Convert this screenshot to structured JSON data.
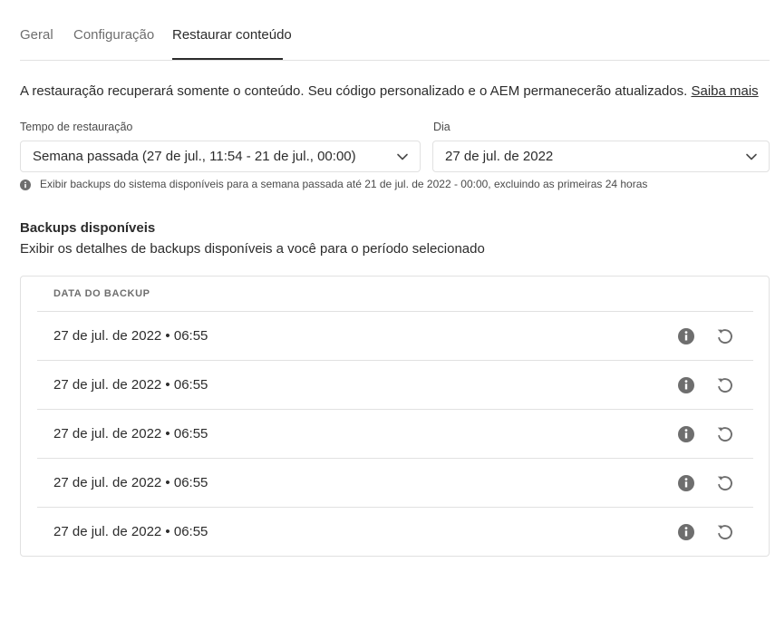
{
  "tabs": [
    {
      "label": "Geral",
      "active": false
    },
    {
      "label": "Configuração",
      "active": false
    },
    {
      "label": "Restaurar conteúdo",
      "active": true
    }
  ],
  "intro": {
    "text": "A restauração recuperará somente o conteúdo. Seu código personalizado e o AEM permanecerão atualizados. ",
    "link_label": "Saiba mais"
  },
  "restore_time": {
    "label": "Tempo de restauração",
    "selected": "Semana passada (27 de jul., 11:54 - 21 de jul., 00:00)"
  },
  "day": {
    "label": "Dia",
    "selected": "27 de jul. de 2022"
  },
  "hint": "Exibir backups do sistema disponíveis para a semana passada até 21 de jul. de 2022 - 00:00, excluindo as primeiras 24 horas",
  "backups": {
    "title": "Backups disponíveis",
    "description": "Exibir os detalhes de backups disponíveis a você para o período selecionado",
    "column_header": "DATA DO BACKUP",
    "rows": [
      {
        "date": "27 de jul. de 2022 • 06:55"
      },
      {
        "date": "27 de jul. de 2022 • 06:55"
      },
      {
        "date": "27 de jul. de 2022 • 06:55"
      },
      {
        "date": "27 de jul. de 2022 • 06:55"
      },
      {
        "date": "27 de jul. de 2022 • 06:55"
      }
    ]
  },
  "icons": {
    "chevron": "chevron-down-icon",
    "info": "info-icon",
    "restore": "restore-icon"
  },
  "colors": {
    "text": "#2c2c2c",
    "muted": "#6e6e6e",
    "border": "#e1e1e1",
    "icon": "#6e6e6e"
  }
}
